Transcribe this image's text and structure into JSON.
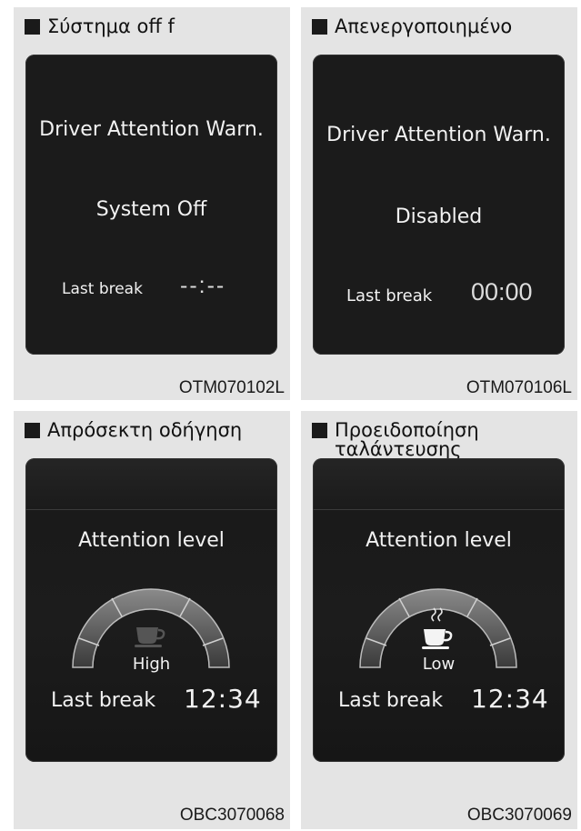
{
  "panels": [
    {
      "heading": "Σύστημα off f",
      "title": "Driver Attention Warn.",
      "status": "System Off",
      "last_break_label": "Last break",
      "last_break_value": "--:--",
      "code": "OTM070102L"
    },
    {
      "heading": "Απενεργοποιημένο",
      "title": "Driver Attention Warn.",
      "status": "Disabled",
      "last_break_label": "Last break",
      "last_break_value": "00:00",
      "code": "OTM070106L"
    },
    {
      "heading": "Απρόσεκτη οδήγηση",
      "title": "Attention level",
      "gauge_level_text": "High",
      "gauge_level": 1.0,
      "last_break_label": "Last break",
      "last_break_value": "12:34",
      "code": "OBC3070068"
    },
    {
      "heading_line1": "Προειδοποίηση",
      "heading_line2": "ταλάντευσης",
      "title": "Attention level",
      "gauge_level_text": "Low",
      "gauge_level": 0.25,
      "last_break_label": "Last break",
      "last_break_value": "12:34",
      "code": "OBC3070069"
    }
  ],
  "colors": {
    "screen": "#1b1b1b",
    "panel_bg": "#e4e4e4",
    "text": "#f2f2f2"
  },
  "icons": [
    "square-bullet-icon",
    "coffee-cup-icon",
    "steam-icon"
  ]
}
